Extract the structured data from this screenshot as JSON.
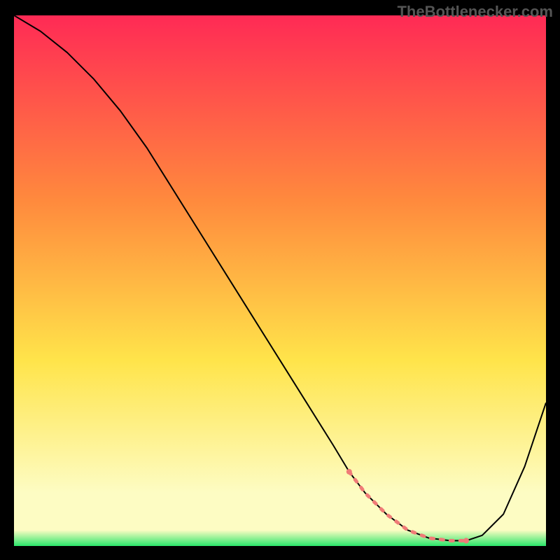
{
  "watermark": "TheBottlenecker.com",
  "chart_data": {
    "type": "line",
    "title": "",
    "xlabel": "",
    "ylabel": "",
    "xlim": [
      0,
      100
    ],
    "ylim": [
      0,
      100
    ],
    "gradient_background": {
      "top": "#ff2a55",
      "mid1": "#ff8a3d",
      "mid2": "#ffe44a",
      "mid3": "#fdfcc3",
      "bottom": "#2ae66a"
    },
    "series": [
      {
        "name": "bottleneck-curve",
        "color": "#000000",
        "stroke_width": 2,
        "x": [
          0,
          5,
          10,
          15,
          20,
          25,
          30,
          35,
          40,
          45,
          50,
          55,
          60,
          63,
          66,
          70,
          74,
          78,
          82,
          85,
          88,
          92,
          96,
          100
        ],
        "y": [
          100,
          97,
          93,
          88,
          82,
          75,
          67,
          59,
          51,
          43,
          35,
          27,
          19,
          14,
          10,
          6,
          3,
          1.5,
          1,
          1,
          2,
          6,
          15,
          27
        ]
      },
      {
        "name": "highlight-segment",
        "color": "#ef7b77",
        "stroke_width": 5,
        "x": [
          63,
          66,
          70,
          74,
          78,
          82,
          85
        ],
        "y": [
          14,
          10,
          6,
          3,
          1.5,
          1,
          1
        ]
      }
    ]
  }
}
